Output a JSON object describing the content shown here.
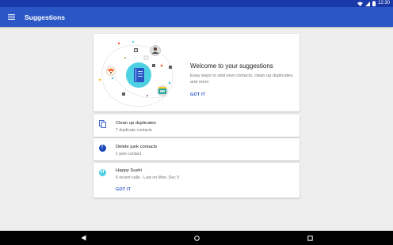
{
  "status_bar": {
    "time": "12:30"
  },
  "app_bar": {
    "title": "Suggestions",
    "menu_icon": "hamburger-menu-icon"
  },
  "hero": {
    "title": "Welcome to your suggestions",
    "description": "Easy ways to add new contacts, clean up duplicates, and more",
    "action": "GOT IT"
  },
  "suggestions": [
    {
      "title": "Clean up duplicates",
      "subtitle": "7 duplicate contacts",
      "icon": "duplicate-copy-icon"
    },
    {
      "title": "Delete junk contacts",
      "subtitle": "1 junk contact",
      "icon": "info-icon"
    },
    {
      "title": "Happy Sushi",
      "subtitle": "6 recent calls · Last on Mon, Dec 5",
      "icon": "contact-avatar-h",
      "avatar_letter": "H",
      "action": "GOT IT"
    }
  ],
  "colors": {
    "status_bar": "#1a39a8",
    "app_bar": "#2a56c6",
    "accent": "#2a56c6",
    "background": "#eeeeee",
    "avatar_teal": "#4dd0e1",
    "info_blue": "#1a47b8"
  }
}
